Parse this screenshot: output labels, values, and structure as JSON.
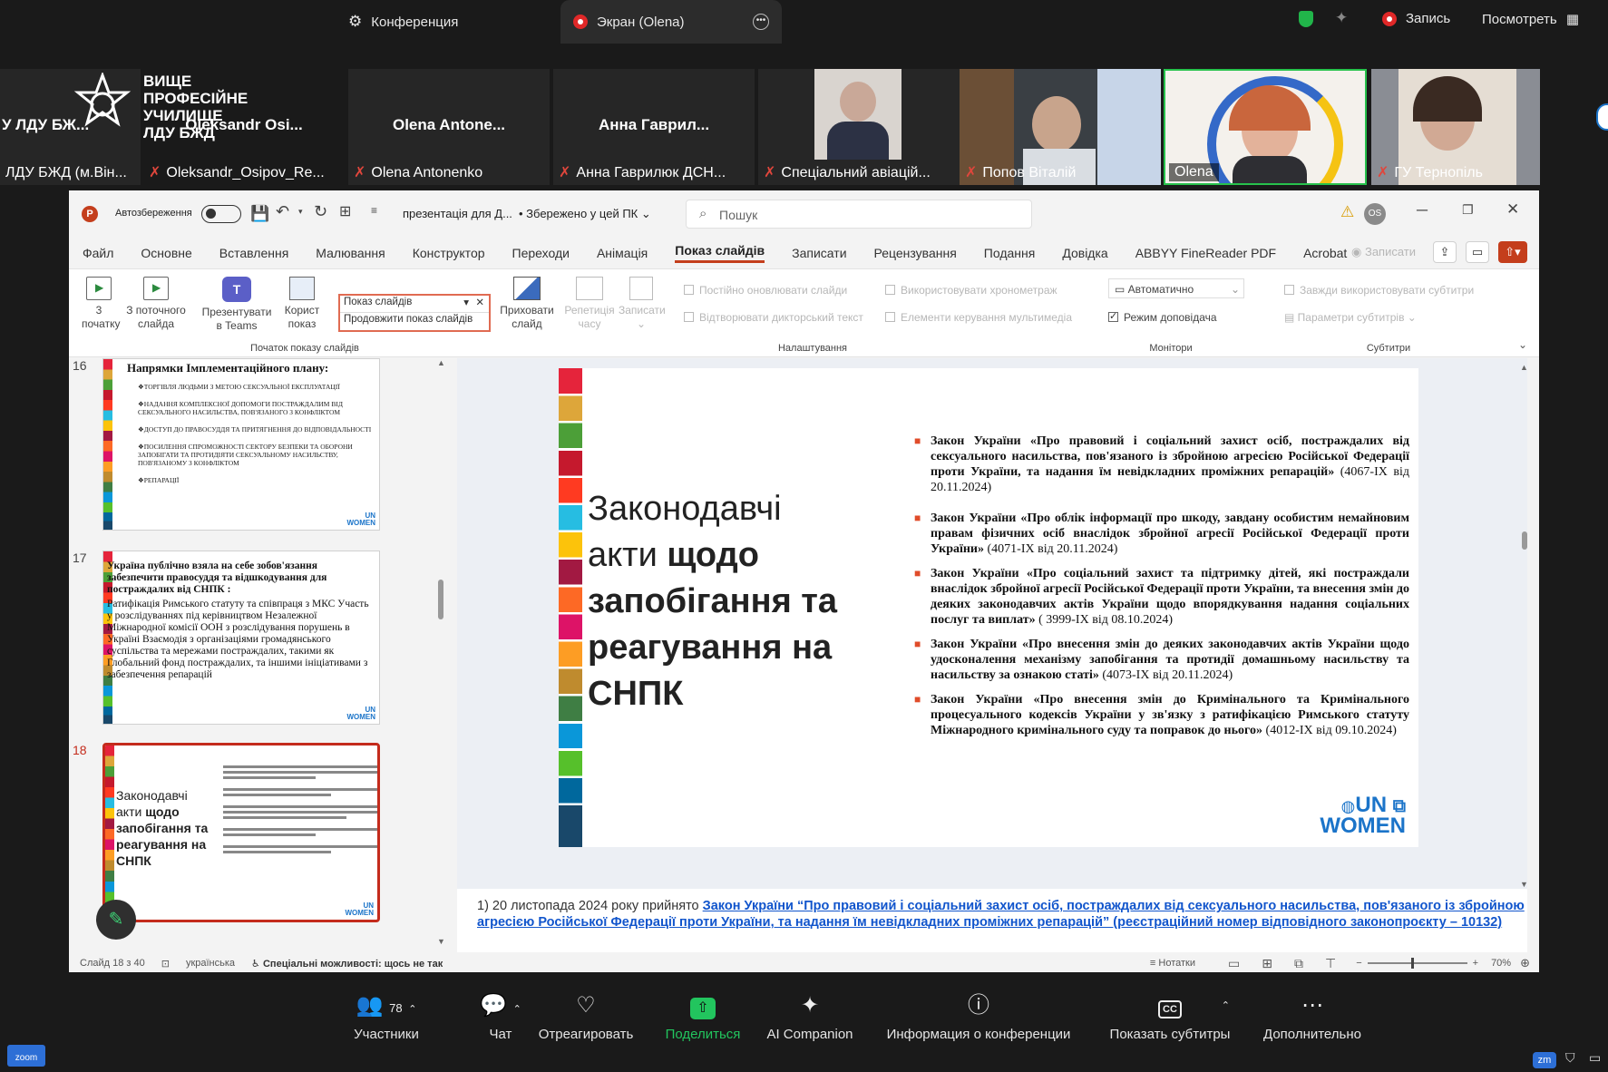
{
  "zoom_top": {
    "conference_tab": "Конференция",
    "screen_tab": "Экран (Olena)",
    "record_label": "Запись",
    "view_label": "Посмотреть"
  },
  "filmstrip": {
    "logo_text": [
      "ВИЩЕ",
      "ПРОФЕСІЙНЕ",
      "УЧИЛИЩЕ",
      "ЛДУ БЖД"
    ],
    "tiles": [
      {
        "big": "У ЛДУ БЖ...",
        "name": "ЛДУ БЖД (м.Він..."
      },
      {
        "big": "Oleksandr Osi...",
        "name": "Oleksandr_Osipov_Re..."
      },
      {
        "big": "Olena Antone...",
        "name": "Olena Antonenko"
      },
      {
        "big": "Анна Гаврил...",
        "name": "Анна Гаврилюк ДСН..."
      },
      {
        "big": "",
        "name": "Спеціальний авіацій..."
      },
      {
        "big": "",
        "name": "Попов Віталій"
      },
      {
        "big": "",
        "name": "Olena"
      },
      {
        "big": "",
        "name": "ГУ Тернопіль"
      }
    ]
  },
  "ppt": {
    "autosave": "Автозбереження",
    "doc_title": "презентація для Д...",
    "saved_status": "• Збережено у цей ПК",
    "search_placeholder": "Пошук",
    "avatar_initials": "OS",
    "menu": [
      "Файл",
      "Основне",
      "Вставлення",
      "Малювання",
      "Конструктор",
      "Переходи",
      "Анімація",
      "Показ слайдів",
      "Записати",
      "Рецензування",
      "Подання",
      "Довідка",
      "ABBYY FineReader PDF",
      "Acrobat"
    ],
    "record_btn": "Записати",
    "ribbon": {
      "from_start": [
        "3",
        "початку"
      ],
      "from_current": [
        "З поточного",
        "слайда"
      ],
      "present_teams": [
        "Презентувати",
        "в Teams"
      ],
      "custom_show": [
        "Корист",
        "показ"
      ],
      "hide_slide": [
        "Приховати",
        "слайд"
      ],
      "rehearse": [
        "Репетиція",
        "часу"
      ],
      "record": "Записати",
      "group_start": "Початок показу слайдів",
      "group_setup": "Налаштування",
      "group_monitors": "Монітори",
      "group_captions": "Субтитри",
      "cb_update": "Постійно оновлювати слайди",
      "cb_narration": "Відтворювати дикторський текст",
      "cb_timings": "Використовувати хронометраж",
      "cb_media": "Елементи керування мультимедіа",
      "monitor_select": "Автоматично",
      "presenter_view": "Режим доповідача",
      "cb_subtitles": "Завжди використовувати субтитри",
      "subtitle_params": "Параметри субтитрів"
    },
    "popup": {
      "title": "Показ слайдів",
      "item": "Продовжити показ слайдів"
    },
    "thumbs": [
      {
        "num": "16",
        "title": "Напрямки Імплементаційного плану:",
        "bullets": [
          "ТОРГІВЛЯ ЛЮДЬМИ З МЕТОЮ СЕКСУАЛЬНОЇ ЕКСПЛУАТАЦІЇ",
          "НАДАННЯ КОМПЛЕКСНОЇ ДОПОМОГИ ПОСТРАЖДАЛИМ ВІД СЕКСУАЛЬНОГО НАСИЛЬСТВА, ПОВ'ЯЗАНОГО З КОНФЛІКТОМ",
          "ДОСТУП ДО ПРАВОСУДДЯ ТА ПРИТЯГНЕННЯ ДО ВІДПОВІДАЛЬНОСТІ",
          "ПОСИЛЕННЯ СПРОМОЖНОСТІ СЕКТОРУ БЕЗПЕКИ ТА ОБОРОНИ ЗАПОБІГАТИ ТА ПРОТИДІЯТИ СЕКСУАЛЬНОМУ НАСИЛЬСТВУ, ПОВ'ЯЗАНОМУ З КОНФЛІКТОМ",
          "РЕПАРАЦІЇ"
        ]
      },
      {
        "num": "17",
        "title": "Україна публічно взяла на себе зобов'язання забезпечити правосуддя та відшкодування для постраждалих від СНПК :",
        "body": "Ратифікація Римського статуту та співпраця з МКС Участь у розслідуваннях під керівництвом Незалежної Міжнародної комісії ООН з розслідування порушень в Україні Взаємодія з організаціями громадянського суспільства та мережами постраждалих, такими як Глобальний фонд постраждалих, та іншими ініціативами з забезпечення репарацій"
      },
      {
        "num": "18",
        "lines": [
          "Законодавчі",
          "акти",
          "щодо",
          "запобігання та",
          "реагування на",
          "СНПК"
        ]
      }
    ],
    "un_logo": {
      "top": "UN",
      "bottom": "WOMEN"
    },
    "slide": {
      "title_l1": "Законодавчі",
      "title_l2a": "акти ",
      "title_l2b": "щодо",
      "title_l3": "запобігання та",
      "title_l4": "реагування на",
      "title_l5": "СНПК",
      "laws": [
        {
          "bold": "Закон України «Про правовий і соціальний захист осіб, постраждалих від сексуального насильства, пов'язаного із збройною агресією Російської Федерації проти України, та надання їм невідкладних проміжних репарацій»",
          "ref": " (4067-IX від 20.11.2024)"
        },
        {
          "bold": "Закон України «Про облік інформації про шкоду, завдану особистим немайновим правам фізичних осіб внаслідок збройної агресії Російської Федерації проти України»",
          "ref": " (4071-IX від 20.11.2024)"
        },
        {
          "bold": "Закон України «Про соціальний захист та підтримку дітей, які постраждали внаслідок збройної агресії Російської Федерації проти України, та внесення змін до деяких законодавчих актів України щодо впорядкування надання соціальних послуг та виплат»",
          "ref": " ( 3999-IX від 08.10.2024)"
        },
        {
          "bold": "Закон України «Про внесення змін до деяких законодавчих актів України щодо удосконалення механізму запобігання та протидії домашньому насильству та насильству за ознакою статі»",
          "ref": " (4073-IX від 20.11.2024)"
        },
        {
          "bold": "Закон України «Про внесення змін до Кримінального та Кримінального процесуального кодексів України у зв'язку з ратифікацією Римського статуту Міжнародного кримінального суду та поправок до нього»",
          "ref": " (4012-IX від 09.10.2024)"
        }
      ]
    },
    "notes": {
      "prefix": "1) 20 листопада 2024 року прийнято ",
      "link": "Закон України “Про правовий і соціальний захист осіб, постраждалих від сексуального насильства, пов'язаного із збройною агресією Російської Федерації проти України, та надання їм невідкладних проміжних репарацій” (реєстраційний номер відповідного законопроєкту – 10132)"
    },
    "status": {
      "slide": "Слайд 18 з 40",
      "lang": "українська",
      "accessibility": "Спеціальні можливості: щось не так",
      "notes_btn": "Нотатки",
      "zoom": "70%"
    }
  },
  "zoom_bottom": {
    "participants_count": "78",
    "participants": "Участники",
    "chat": "Чат",
    "react": "Отреагировать",
    "share": "Поделиться",
    "ai": "AI Companion",
    "info": "Информация о конференции",
    "captions": "Показать субтитры",
    "more": "Дополнительно",
    "taskbar_app": "zoom"
  },
  "colors": {
    "zoom_bg": "#1a1a1a",
    "share_green": "#22c55e",
    "ppt_accent": "#c43e1c",
    "thumb_selected": "#c42b1c"
  }
}
